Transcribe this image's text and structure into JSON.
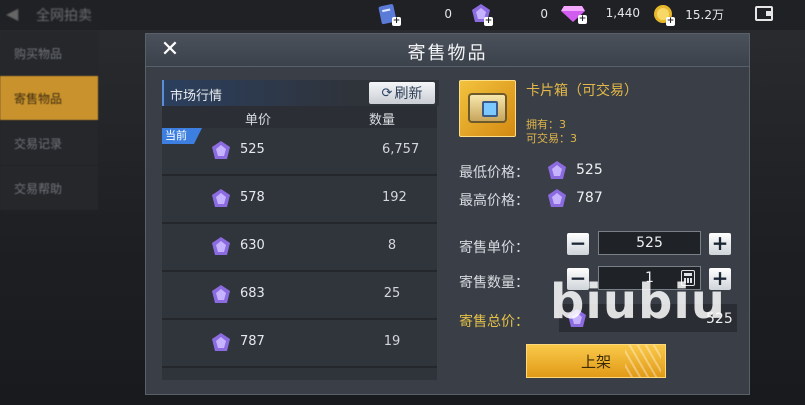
{
  "topbar": {
    "title": "全网拍卖",
    "resources": [
      {
        "name": "card-ticket",
        "value": "0"
      },
      {
        "name": "purple-crystal",
        "value": "0"
      },
      {
        "name": "diamond",
        "value": "1,440"
      },
      {
        "name": "gold-coin",
        "value": "15.2万"
      }
    ]
  },
  "left_menu": {
    "items": [
      "购买物品",
      "寄售物品",
      "交易记录",
      "交易帮助"
    ]
  },
  "dialog": {
    "title": "寄售物品",
    "market": {
      "label": "市场行情",
      "refresh": "刷新",
      "col_price": "单价",
      "col_qty": "数量",
      "current_tag": "当前",
      "rows": [
        {
          "price": "525",
          "qty": "6,757"
        },
        {
          "price": "578",
          "qty": "192"
        },
        {
          "price": "630",
          "qty": "8"
        },
        {
          "price": "683",
          "qty": "25"
        },
        {
          "price": "787",
          "qty": "19"
        }
      ]
    },
    "item": {
      "name": "卡片箱（可交易）",
      "owned": "拥有：3",
      "tradable": "可交易：3"
    },
    "min_price_label": "最低价格：",
    "min_price": "525",
    "max_price_label": "最高价格：",
    "max_price": "787",
    "unit_price_label": "寄售单价：",
    "unit_price": "525",
    "quantity_label": "寄售数量：",
    "quantity": "1",
    "total_label": "寄售总价：",
    "total": "525",
    "list_button": "上架",
    "minus": "−",
    "plus": "+"
  },
  "watermark": "biubiu",
  "colors": {
    "accent_gold": "#e4b848",
    "button_orange": "#f0b030",
    "current_tag_blue": "#3d7fe0",
    "panel_bg": "#3a3f47"
  }
}
